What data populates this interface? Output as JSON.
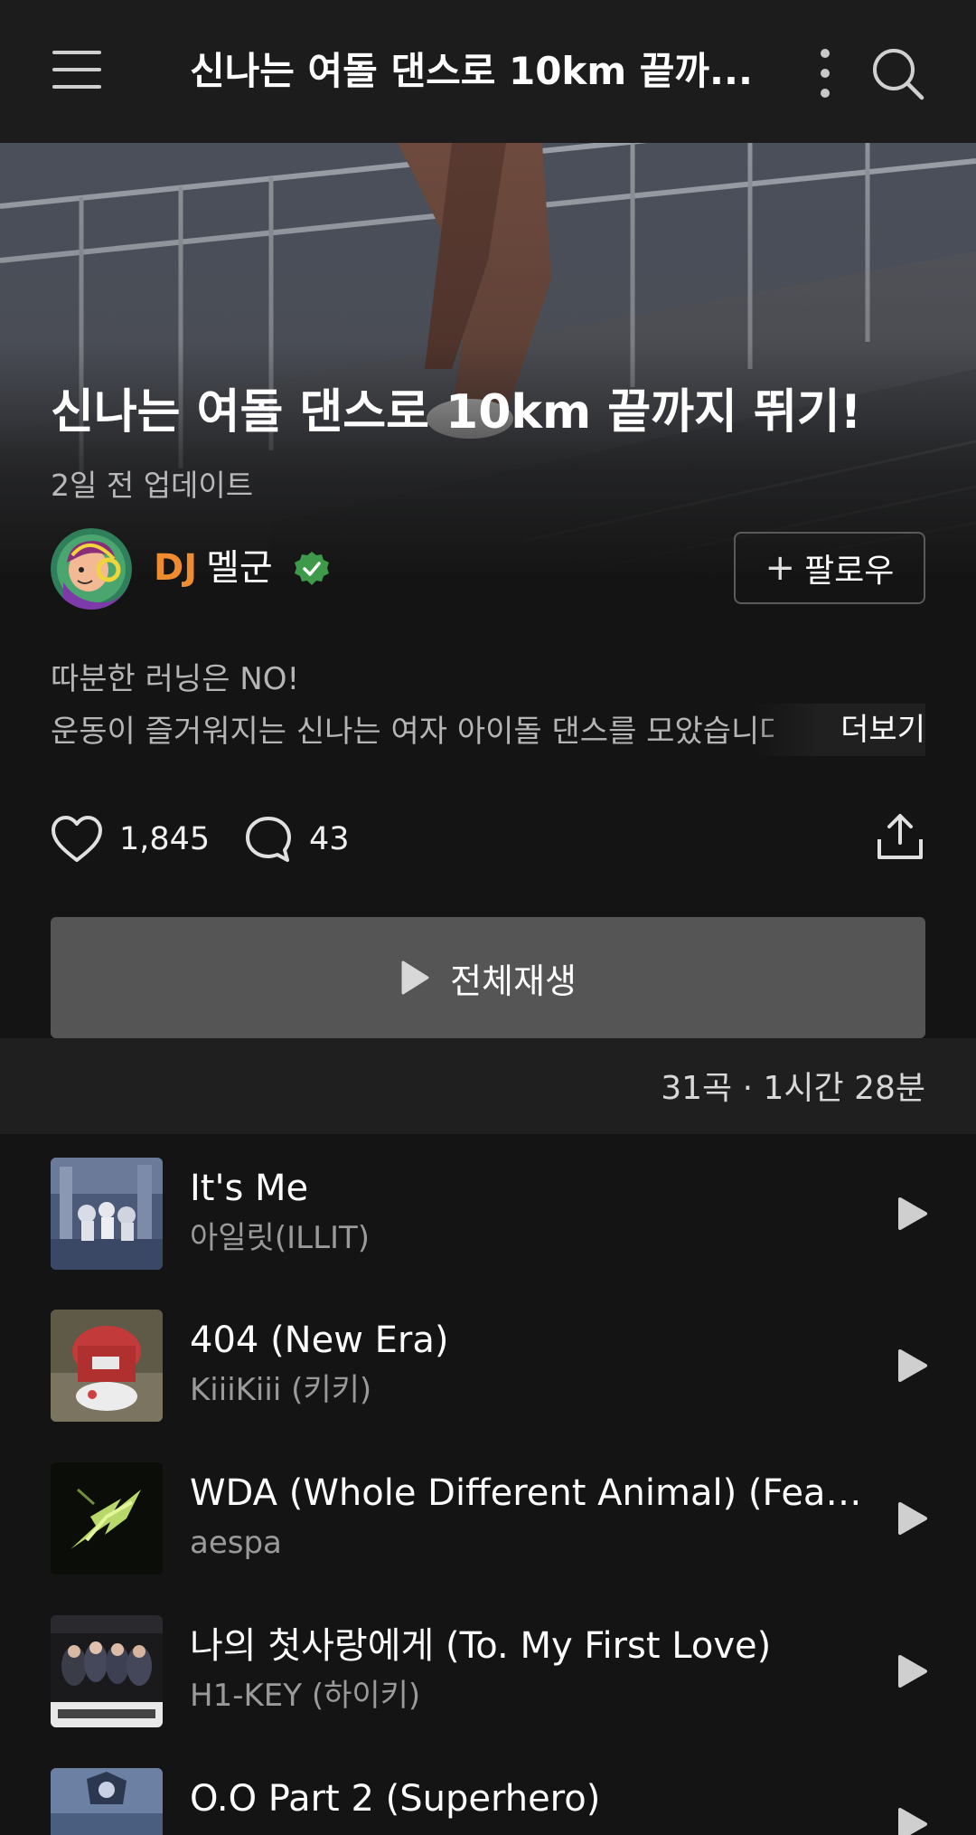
{
  "header": {
    "title": "신나는 여돌 댄스로 10km 끝까..."
  },
  "playlist": {
    "title": "신나는 여돌 댄스로 10km 끝까지 뛰기!",
    "updated": "2일 전 업데이트",
    "dj_prefix": "DJ",
    "dj_name": "멜군",
    "follow_label": "팔로우",
    "description_line1": "따분한 러닝은 NO!",
    "description_line2": "운동이 즐거워지는 신나는 여자 아이돌 댄스를 모았습니다",
    "more_label": "더보기",
    "likes": "1,845",
    "comments": "43",
    "play_all_label": "전체재생",
    "summary": "31곡 · 1시간 28분"
  },
  "tracks": [
    {
      "title": "It's Me",
      "artist": "아일릿(ILLIT)"
    },
    {
      "title": "404 (New Era)",
      "artist": "KiiiKiii (키키)"
    },
    {
      "title": "WDA (Whole Different Animal) (Feat. G...",
      "artist": "aespa"
    },
    {
      "title": "나의 첫사랑에게 (To. My First Love)",
      "artist": "H1-KEY (하이키)"
    },
    {
      "title": "O.O Part 2 (Superhero)",
      "artist": ""
    }
  ],
  "colors": {
    "background": "#141414",
    "header_bg": "#1c1c1c",
    "dj_accent": "#f08c30",
    "verified": "#3e9a4a",
    "play_all_bg": "#555555"
  },
  "icons": [
    "menu-icon",
    "more-vertical-icon",
    "search-icon",
    "verified-icon",
    "plus-icon",
    "heart-icon",
    "comment-icon",
    "share-icon",
    "play-icon"
  ]
}
